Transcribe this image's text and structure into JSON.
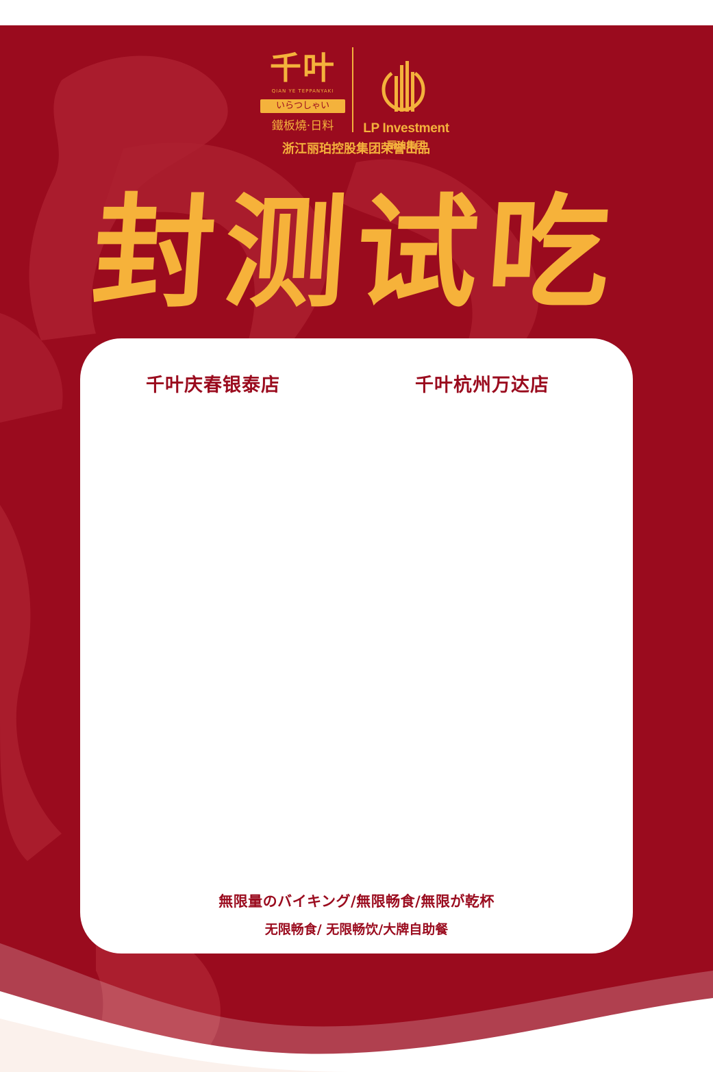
{
  "brand": {
    "qianye_cn": "千叶",
    "qianye_en": "QIAN YE TEPPANYAKI",
    "qianye_jp": "いらつしゃい",
    "qianye_sub": "鐵板燒·日料",
    "lp_en": "LP Investment",
    "lp_cn": "丽珀集团",
    "lp_icon": "building-arch-logo-icon"
  },
  "tagline": "浙江丽珀控股集团荣誉出品",
  "headline": "封测试吃",
  "stores": {
    "left": "千叶庆春银泰店",
    "right": "千叶杭州万达店"
  },
  "slogans": {
    "jp": "無限量のバイキング/無限畅食/無限が乾杯",
    "cn": "无限畅食/ 无限畅饮/大牌自助餐"
  },
  "colors": {
    "background": "#9a0b1e",
    "gold": "#f4b23c",
    "panel": "#ffffff",
    "text_red": "#9a0b1e"
  }
}
